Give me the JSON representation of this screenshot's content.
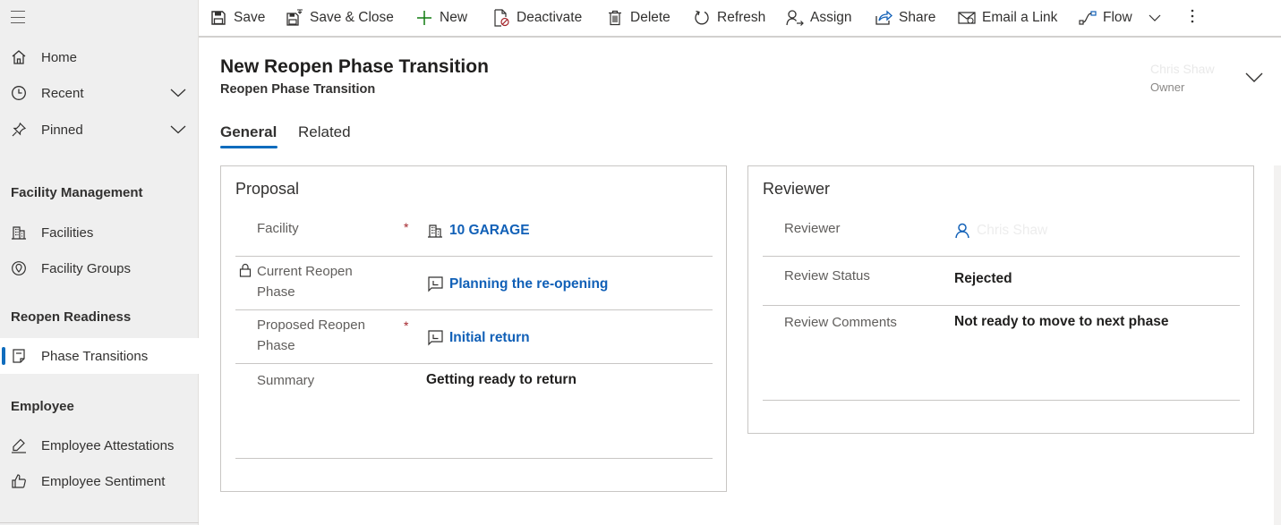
{
  "sidebar": {
    "top_items": [
      {
        "label": "Home",
        "icon": "home-icon"
      },
      {
        "label": "Recent",
        "icon": "clock-icon"
      },
      {
        "label": "Pinned",
        "icon": "pin-icon"
      }
    ],
    "groups": [
      {
        "title": "Facility Management",
        "items": [
          {
            "label": "Facilities"
          },
          {
            "label": "Facility Groups"
          }
        ]
      },
      {
        "title": "Reopen Readiness",
        "items": [
          {
            "label": "Phase Transitions"
          }
        ]
      },
      {
        "title": "Employee",
        "items": [
          {
            "label": "Employee Attestations"
          },
          {
            "label": "Employee Sentiment"
          }
        ]
      }
    ]
  },
  "toolbar": {
    "save": "Save",
    "save_close": "Save & Close",
    "new": "New",
    "deactivate": "Deactivate",
    "delete": "Delete",
    "refresh": "Refresh",
    "assign": "Assign",
    "share": "Share",
    "email_link": "Email a Link",
    "flow": "Flow"
  },
  "header": {
    "title": "New Reopen Phase Transition",
    "subtitle": "Reopen Phase Transition",
    "owner_name": "Chris Shaw",
    "owner_label": "Owner"
  },
  "tabs": [
    {
      "label": "General"
    },
    {
      "label": "Related"
    }
  ],
  "proposal": {
    "title": "Proposal",
    "facility_label": "Facility",
    "facility_value": "10 GARAGE",
    "current_phase_label_1": "Current Reopen",
    "current_phase_label_2": "Phase",
    "current_phase_value": "Planning the re-opening",
    "proposed_phase_label_1": "Proposed Reopen",
    "proposed_phase_label_2": "Phase",
    "proposed_phase_value": "Initial return",
    "summary_label": "Summary",
    "summary_value": "Getting ready to return",
    "required_mark": "*"
  },
  "reviewer": {
    "title": "Reviewer",
    "reviewer_label": "Reviewer",
    "reviewer_value": "Chris Shaw",
    "status_label": "Review Status",
    "status_value": "Rejected",
    "comments_label": "Review Comments",
    "comments_value": "Not ready to move to next phase"
  },
  "colors": {
    "accent": "#0f6cbd",
    "link": "#1160b7",
    "required": "#a4262c",
    "new_icon": "#107c10"
  }
}
